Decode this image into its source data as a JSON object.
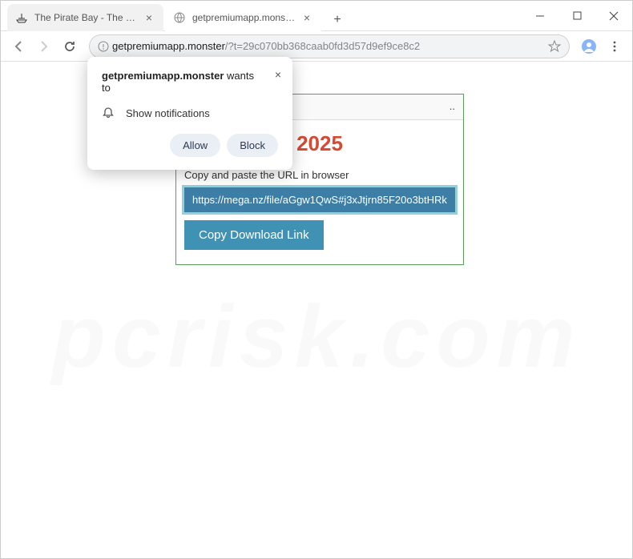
{
  "window": {
    "tabs": [
      {
        "title": "The Pirate Bay - The galaxy's m",
        "active": false
      },
      {
        "title": "getpremiumapp.monster/?t=29",
        "active": true
      }
    ]
  },
  "address": {
    "domain": "getpremiumapp.monster",
    "path": "/?t=29c070bb368caab0fd3d57d9ef9ce8c2"
  },
  "notification": {
    "domain": "getpremiumapp.monster",
    "wants": "wants to",
    "permission": "Show notifications",
    "allow": "Allow",
    "block": "Block"
  },
  "page": {
    "header_tail": "..",
    "year": "2025",
    "instruction": "Copy and paste the URL in browser",
    "download_url": "https://mega.nz/file/aGgw1QwS#j3xJtjrn85F20o3btHRk",
    "copy_button": "Copy Download Link"
  },
  "watermark": "pcrisk.com"
}
